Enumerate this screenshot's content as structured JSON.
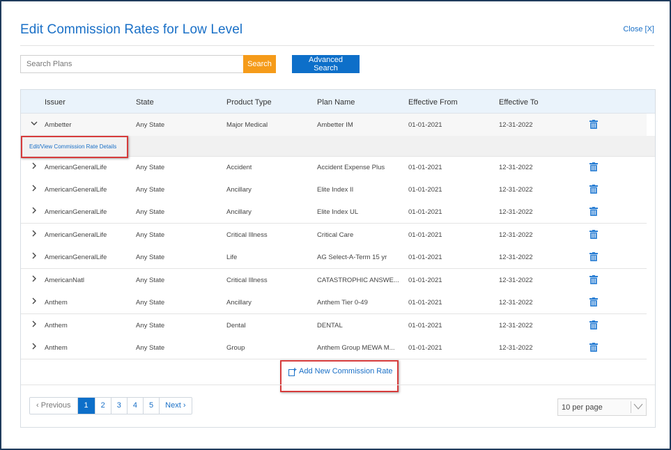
{
  "header": {
    "title": "Edit Commission Rates for Low Level",
    "close_label": "Close [X]"
  },
  "search": {
    "placeholder": "Search Plans",
    "search_label": "Search",
    "advanced_label": "Advanced Search"
  },
  "table": {
    "columns": [
      "Issuer",
      "State",
      "Product Type",
      "Plan Name",
      "Effective From",
      "Effective To"
    ],
    "rows": [
      {
        "issuer": "Ambetter",
        "state": "Any State",
        "product": "Major Medical",
        "plan": "Ambetter IM",
        "from": "01-01-2021",
        "to": "12-31-2022",
        "expanded": true
      },
      {
        "issuer": "AmericanGeneralLife",
        "state": "Any State",
        "product": "Accident",
        "plan": "Accident Expense Plus",
        "from": "01-01-2021",
        "to": "12-31-2022"
      },
      {
        "issuer": "AmericanGeneralLife",
        "state": "Any State",
        "product": "Ancillary",
        "plan": "Elite Index II",
        "from": "01-01-2021",
        "to": "12-31-2022"
      },
      {
        "issuer": "AmericanGeneralLife",
        "state": "Any State",
        "product": "Ancillary",
        "plan": "Elite Index UL",
        "from": "01-01-2021",
        "to": "12-31-2022"
      },
      {
        "issuer": "AmericanGeneralLife",
        "state": "Any State",
        "product": "Critical Illness",
        "plan": "Critical Care",
        "from": "01-01-2021",
        "to": "12-31-2022"
      },
      {
        "issuer": "AmericanGeneralLife",
        "state": "Any State",
        "product": "Life",
        "plan": "AG Select-A-Term 15 yr",
        "from": "01-01-2021",
        "to": "12-31-2022"
      },
      {
        "issuer": "AmericanNatl",
        "state": "Any State",
        "product": "Critical Illness",
        "plan": "CATASTROPHIC ANSWE...",
        "from": "01-01-2021",
        "to": "12-31-2022"
      },
      {
        "issuer": "Anthem",
        "state": "Any State",
        "product": "Ancillary",
        "plan": "Anthem Tier 0-49",
        "from": "01-01-2021",
        "to": "12-31-2022"
      },
      {
        "issuer": "Anthem",
        "state": "Any State",
        "product": "Dental",
        "plan": "DENTAL",
        "from": "01-01-2021",
        "to": "12-31-2022"
      },
      {
        "issuer": "Anthem",
        "state": "Any State",
        "product": "Group",
        "plan": "Anthem Group MEWA M...",
        "from": "01-01-2021",
        "to": "12-31-2022"
      }
    ],
    "detail_link": "Edit/View Commission Rate Details",
    "add_label": "Add New Commission Rate"
  },
  "pagination": {
    "previous": "Previous",
    "pages": [
      "1",
      "2",
      "3",
      "4",
      "5"
    ],
    "current": "1",
    "next": "Next",
    "per_page": "10 per page"
  },
  "icons": {
    "chevron_right": "›",
    "chevron_down": "⌄"
  },
  "colors": {
    "accent": "#0d6fc9",
    "search_button": "#f59b1a",
    "highlight_border": "#d63b3b",
    "link": "#1a70c7",
    "header_bg": "#eaf3fb"
  }
}
